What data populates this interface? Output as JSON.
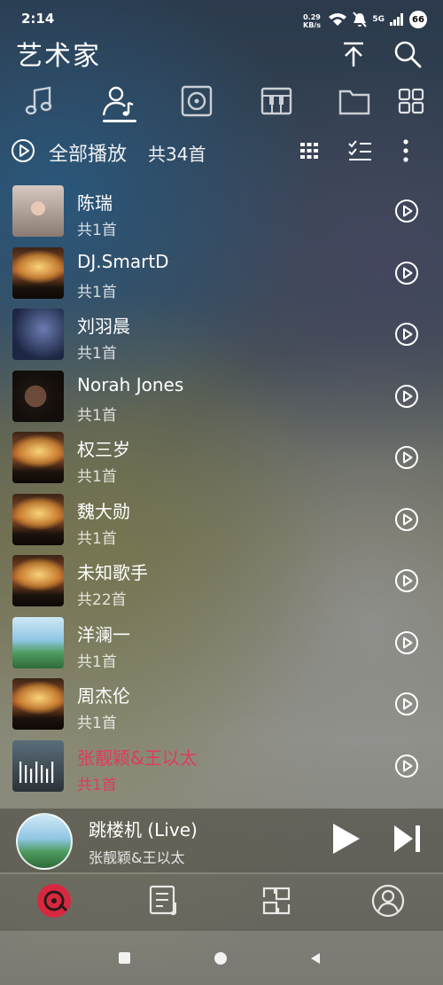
{
  "status": {
    "time": "2:14",
    "net_speed": "0.29",
    "net_unit": "KB/s",
    "signal": "5G",
    "battery": "66"
  },
  "header": {
    "title": "艺术家"
  },
  "tabs": [
    "music-note-icon",
    "artist-icon",
    "album-icon",
    "piano-icon",
    "folder-icon",
    "grid-icon"
  ],
  "play_all": {
    "label": "全部播放",
    "count": "共34首"
  },
  "artists": [
    {
      "name": "陈瑞",
      "count": "共1首",
      "thumb": "t-portrait"
    },
    {
      "name": "DJ.SmartD",
      "count": "共1首",
      "thumb": "t-concert"
    },
    {
      "name": "刘羽晨",
      "count": "共1首",
      "thumb": "t-couple"
    },
    {
      "name": "Norah Jones",
      "count": "共1首",
      "thumb": "t-norah"
    },
    {
      "name": "权三岁",
      "count": "共1首",
      "thumb": "t-concert"
    },
    {
      "name": "魏大勋",
      "count": "共1首",
      "thumb": "t-concert"
    },
    {
      "name": "未知歌手",
      "count": "共22首",
      "thumb": "t-concert"
    },
    {
      "name": "洋澜一",
      "count": "共1首",
      "thumb": "t-sky"
    },
    {
      "name": "周杰伦",
      "count": "共1首",
      "thumb": "t-concert"
    },
    {
      "name": "张靓颖&王以太",
      "count": "共1首",
      "thumb": "t-bars",
      "active": true
    }
  ],
  "now_playing": {
    "song": "跳楼机 (Live)",
    "artist": "张靓颖&王以太"
  },
  "colors": {
    "accent": "#e23a5a"
  }
}
